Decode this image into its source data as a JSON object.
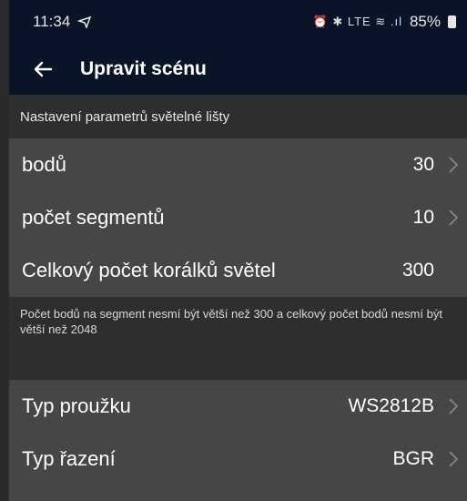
{
  "status_bar": {
    "time": "11:34",
    "icons_text": "⏰ ✱ LTE ≋ .ıl",
    "battery": "85%"
  },
  "app_bar": {
    "title": "Upravit scénu"
  },
  "section1": {
    "header": "Nastavení parametrů světelné lišty",
    "rows": [
      {
        "label": "bodů",
        "value": "30"
      },
      {
        "label": "počet segmentů",
        "value": "10"
      },
      {
        "label": "Celkový počet korálků světel",
        "value": "300"
      }
    ],
    "note": "Počet bodů na segment nesmí být větší než 300 a celkový počet bodů nesmí být větší než 2048"
  },
  "section2": {
    "rows": [
      {
        "label": "Typ proužku",
        "value": "WS2812B"
      },
      {
        "label": "Typ řazení",
        "value": "BGR"
      }
    ]
  },
  "colors": {
    "app_bar": "#0a1428",
    "row_bg": "#464646",
    "section_bg": "#2e2e2e"
  }
}
